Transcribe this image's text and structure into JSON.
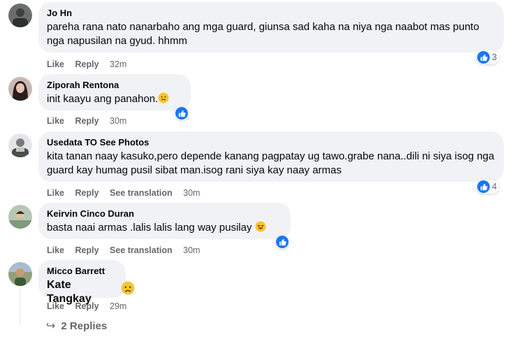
{
  "comments": [
    {
      "author": "Jo Hn",
      "text": "pareha rana nato nanarbaho ang mga guard, giunsa sad kaha na niya nga naabot mas punto nga napusilan na gyud. hhmm",
      "actions": [
        "Like",
        "Reply"
      ],
      "time": "32m",
      "reaction_count": "3"
    },
    {
      "author": "Ziporah Rentona",
      "text": "init kaayu ang panahon.",
      "actions": [
        "Like",
        "Reply"
      ],
      "time": "30m",
      "reaction_count": ""
    },
    {
      "author": "Usedata TO See Photos",
      "text": "kita tanan naay kasuko,pero depende kanang pagpatay ug tawo.grabe nana..dili ni siya isog nga guard kay humag pusil sibat man.isog rani siya kay naay armas",
      "actions": [
        "Like",
        "Reply",
        "See translation"
      ],
      "time": "30m",
      "reaction_count": "4"
    },
    {
      "author": "Keirvin Cinco Duran",
      "text": "basta naai armas .lalis lalis lang way pusilay",
      "actions": [
        "Like",
        "Reply",
        "See translation"
      ],
      "time": "30m",
      "reaction_count": ""
    },
    {
      "author": "Micco Barrett",
      "text": "Kate Tangkay",
      "actions": [
        "Like",
        "Reply"
      ],
      "time": "29m",
      "reaction_count": ""
    }
  ],
  "replies_label": "2 Replies",
  "colors": {
    "bubble": "#f0f2f5",
    "like_blue": "#1877f2",
    "meta_gray": "#65676b"
  }
}
